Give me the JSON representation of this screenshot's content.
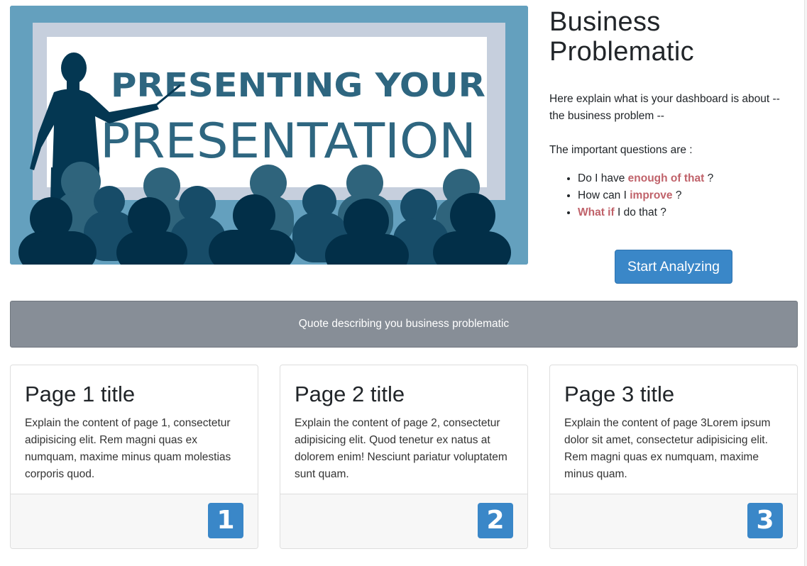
{
  "hero": {
    "title_line1": "PRESENTING YOUR",
    "title_line2": "PRESENTATION"
  },
  "intro": {
    "title_line1": "Business",
    "title_line2": "Problematic",
    "description": "Here explain what is your dashboard is about -- the business problem --",
    "questions_lead": "The important questions are :",
    "questions": [
      {
        "pre": "Do I have ",
        "em": "enough of that",
        "post": " ?"
      },
      {
        "pre": "How can I ",
        "em": "improve",
        "post": " ?"
      },
      {
        "pre": "",
        "em": "What if",
        "post": " I do that ?"
      }
    ],
    "button_label": "Start Analyzing"
  },
  "quote": "Quote describing you business problematic",
  "cards": [
    {
      "title": "Page 1 title",
      "text": "Explain the content of page 1, consectetur adipisicing elit. Rem magni quas ex numquam, maxime minus quam molestias corporis quod.",
      "badge": "1"
    },
    {
      "title": "Page 2 title",
      "text": "Explain the content of page 2, consectetur adipisicing elit. Quod tenetur ex natus at dolorem enim! Nesciunt pariatur voluptatem sunt quam.",
      "badge": "2"
    },
    {
      "title": "Page 3 title",
      "text": "Explain the content of page 3Lorem ipsum dolor sit amet, consectetur adipisicing elit. Rem magni quas ex numquam, maxime minus quam.",
      "badge": "3"
    }
  ],
  "colors": {
    "accent": "#3a87c8",
    "emphasis": "#c0626a",
    "quote_bg": "#878e97",
    "hero_bg": "#64a0be"
  }
}
